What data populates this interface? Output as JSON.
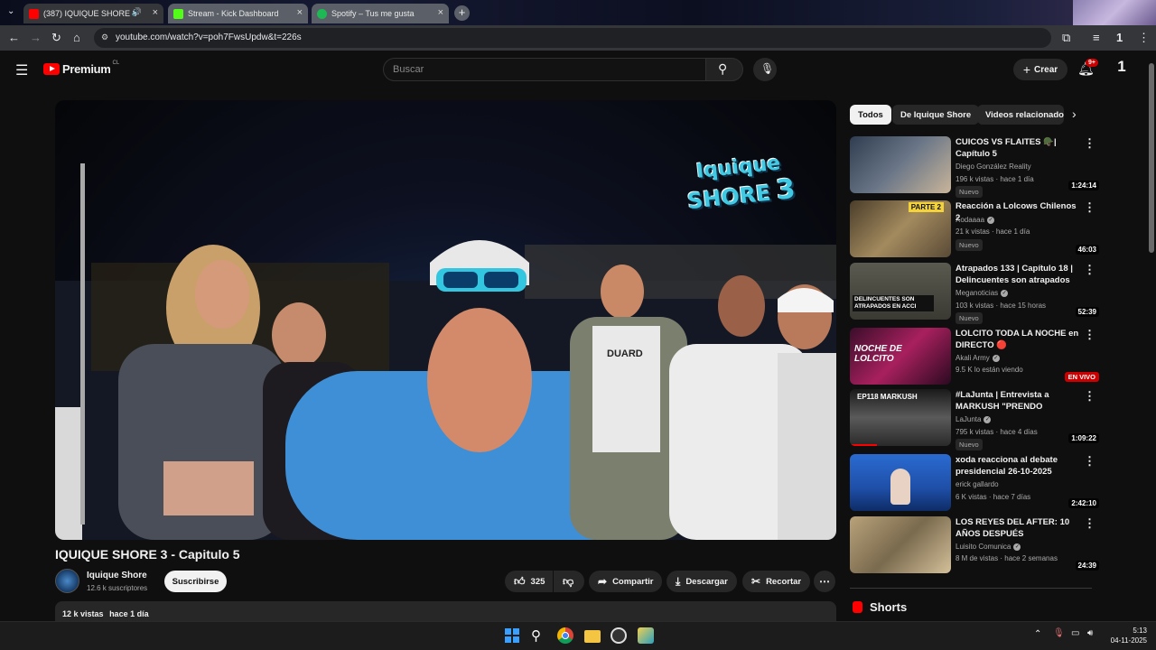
{
  "browser": {
    "tabs": [
      {
        "label": "(387) IQUIQUE SHORE 3",
        "color": "#ff0000",
        "active": true
      },
      {
        "label": "Stream - Kick Dashboard",
        "color": "#53fc18",
        "active": false
      },
      {
        "label": "Spotify – Tus me gusta",
        "color": "#1db954",
        "active": false
      }
    ],
    "url": "youtube.com/watch?v=poh7FwsUpdw&t=226s"
  },
  "header": {
    "logo_text": "Premium",
    "region": "CL",
    "search_placeholder": "Buscar",
    "create_label": "Crear",
    "notifications_badge": "9+"
  },
  "video": {
    "title": "IQUIQUE SHORE 3 - Capitulo 5",
    "overlay_logo_line1": "Iquique",
    "overlay_logo_line2": "SHORE",
    "overlay_logo_num": "3",
    "shirt_text": "DUARD",
    "channel": "Iquique Shore",
    "subscribers": "12.6 k suscriptores",
    "subscribe_label": "Suscribirse",
    "likes": "325",
    "share_label": "Compartir",
    "download_label": "Descargar",
    "clip_label": "Recortar",
    "views": "12 k vistas",
    "uploaded": "hace 1 día"
  },
  "sidebar": {
    "chips": [
      "Todos",
      "De Iquique Shore",
      "Videos relacionados"
    ],
    "recommendations": [
      {
        "title": "CUICOS VS FLAITES 🪖| Capítulo 5",
        "channel": "Diego González Reality",
        "verified": false,
        "meta": "196 k vistas · hace 1 día",
        "duration": "1:24:14",
        "badge": "Nuevo",
        "thumb_bg": "#3b4a5c",
        "thumb_text": ""
      },
      {
        "title": "Reacción a Lolcows Chilenos 2",
        "channel": "Xodaaaa",
        "verified": true,
        "meta": "21 k vistas · hace 1 día",
        "duration": "46:03",
        "badge": "Nuevo",
        "thumb_bg": "#6d5a3a",
        "thumb_text": "PARTE 2"
      },
      {
        "title": "Atrapados 133 | Capítulo 18 | Delincuentes son atrapados e...",
        "channel": "Meganoticias",
        "verified": true,
        "meta": "103 k vistas · hace 15 horas",
        "duration": "52:39",
        "badge": "Nuevo",
        "thumb_bg": "#4a4a44",
        "thumb_text": "DELINCUENTES SON ATRAPADOS EN ACCI"
      },
      {
        "title": "LOLCITO TODA LA NOCHE en DIRECTO 🔴",
        "channel": "Akali Army",
        "verified": true,
        "meta": "9.5 K lo están viendo",
        "live": "EN VIVO",
        "badge": "",
        "thumb_bg": "#7a1a4a",
        "thumb_text": "NOCHE DE LOLCITO"
      },
      {
        "title": "#LaJunta | Entrevista a MARKUSH \"PRENDO STREAM...",
        "channel": "LaJunta",
        "verified": true,
        "meta": "795 k vistas · hace 4 días",
        "duration": "1:09:22",
        "badge": "Nuevo",
        "thumb_bg": "#2b2b2b",
        "thumb_text": "EP118 MARKUSH"
      },
      {
        "title": "xoda reacciona al debate presidencial 26-10-2025",
        "channel": "erick gallardo",
        "verified": false,
        "meta": "6 K vistas · hace 7 días",
        "duration": "2:42:10",
        "badge": "",
        "thumb_bg": "#1f4fa8",
        "thumb_text": ""
      },
      {
        "title": "LOS REYES DEL AFTER: 10 AÑOS DESPUÉS",
        "channel": "Luisito Comunica",
        "verified": true,
        "meta": "8 M de vistas · hace 2 semanas",
        "duration": "24:39",
        "badge": "",
        "thumb_bg": "#8a7a5a",
        "thumb_text": ""
      }
    ],
    "shorts_label": "Shorts"
  },
  "taskbar": {
    "time": "5:13",
    "date": "04-11-2025"
  },
  "colors": {
    "accent_red": "#ff0000",
    "yt_bg": "#0f0f0f",
    "chip_bg": "#272727"
  }
}
